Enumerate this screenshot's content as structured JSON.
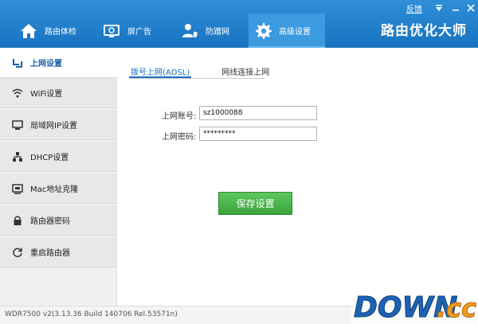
{
  "header": {
    "tabs": [
      {
        "label": "路由体检",
        "icon": "home-icon"
      },
      {
        "label": "屏广告",
        "icon": "monitor-icon"
      },
      {
        "label": "防蹭网",
        "icon": "user-shield-icon"
      },
      {
        "label": "高级设置",
        "icon": "gear-icon"
      }
    ],
    "active_tab": 3,
    "feedback": "反馈",
    "brand": "路由优化大师"
  },
  "sidebar": {
    "items": [
      {
        "label": "上网设置",
        "icon": "router-icon"
      },
      {
        "label": "WiFi设置",
        "icon": "wifi-icon"
      },
      {
        "label": "局域网IP设置",
        "icon": "lan-icon"
      },
      {
        "label": "DHCP设置",
        "icon": "dhcp-icon"
      },
      {
        "label": "Mac地址克隆",
        "icon": "mac-icon"
      },
      {
        "label": "路由器密码",
        "icon": "lock-icon"
      },
      {
        "label": "重启路由器",
        "icon": "restart-icon"
      }
    ],
    "active_index": 0
  },
  "main": {
    "subtabs": [
      {
        "label": "拨号上网(ADSL)"
      },
      {
        "label": "网线连接上网"
      }
    ],
    "account_label": "上网账号:",
    "account_value": "sz1000088",
    "password_label": "上网密码:",
    "password_value": "*********",
    "save_label": "保存设置"
  },
  "footer": {
    "version": "WDR7500 v2(3.13.36 Build 140706 Rel.53571n)"
  },
  "watermark": {
    "text": "DOWN.cc"
  },
  "colors": {
    "header_blue": "#1e7cc8",
    "save_green": "#4cb84c",
    "accent_text": "#1a6fc0"
  }
}
